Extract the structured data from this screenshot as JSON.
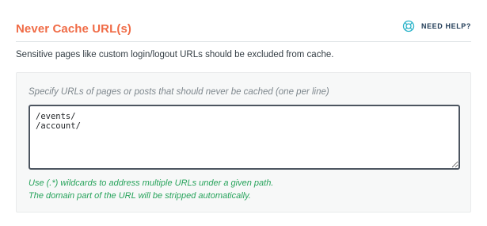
{
  "section": {
    "title": "Never Cache URL(s)",
    "help_label": "NEED HELP?",
    "help_icon": "lifebuoy-icon",
    "description": "Sensitive pages like custom login/logout URLs should be excluded from cache."
  },
  "field": {
    "label": "Specify URLs of pages or posts that should never be cached (one per line)",
    "value": "/events/\n/account/",
    "hints": [
      "Use (.*) wildcards to address multiple URLs under a given path.",
      "The domain part of the URL will be stripped automatically."
    ]
  },
  "colors": {
    "title": "#f06c47",
    "help": "#213c57",
    "hint": "#27a35b"
  }
}
